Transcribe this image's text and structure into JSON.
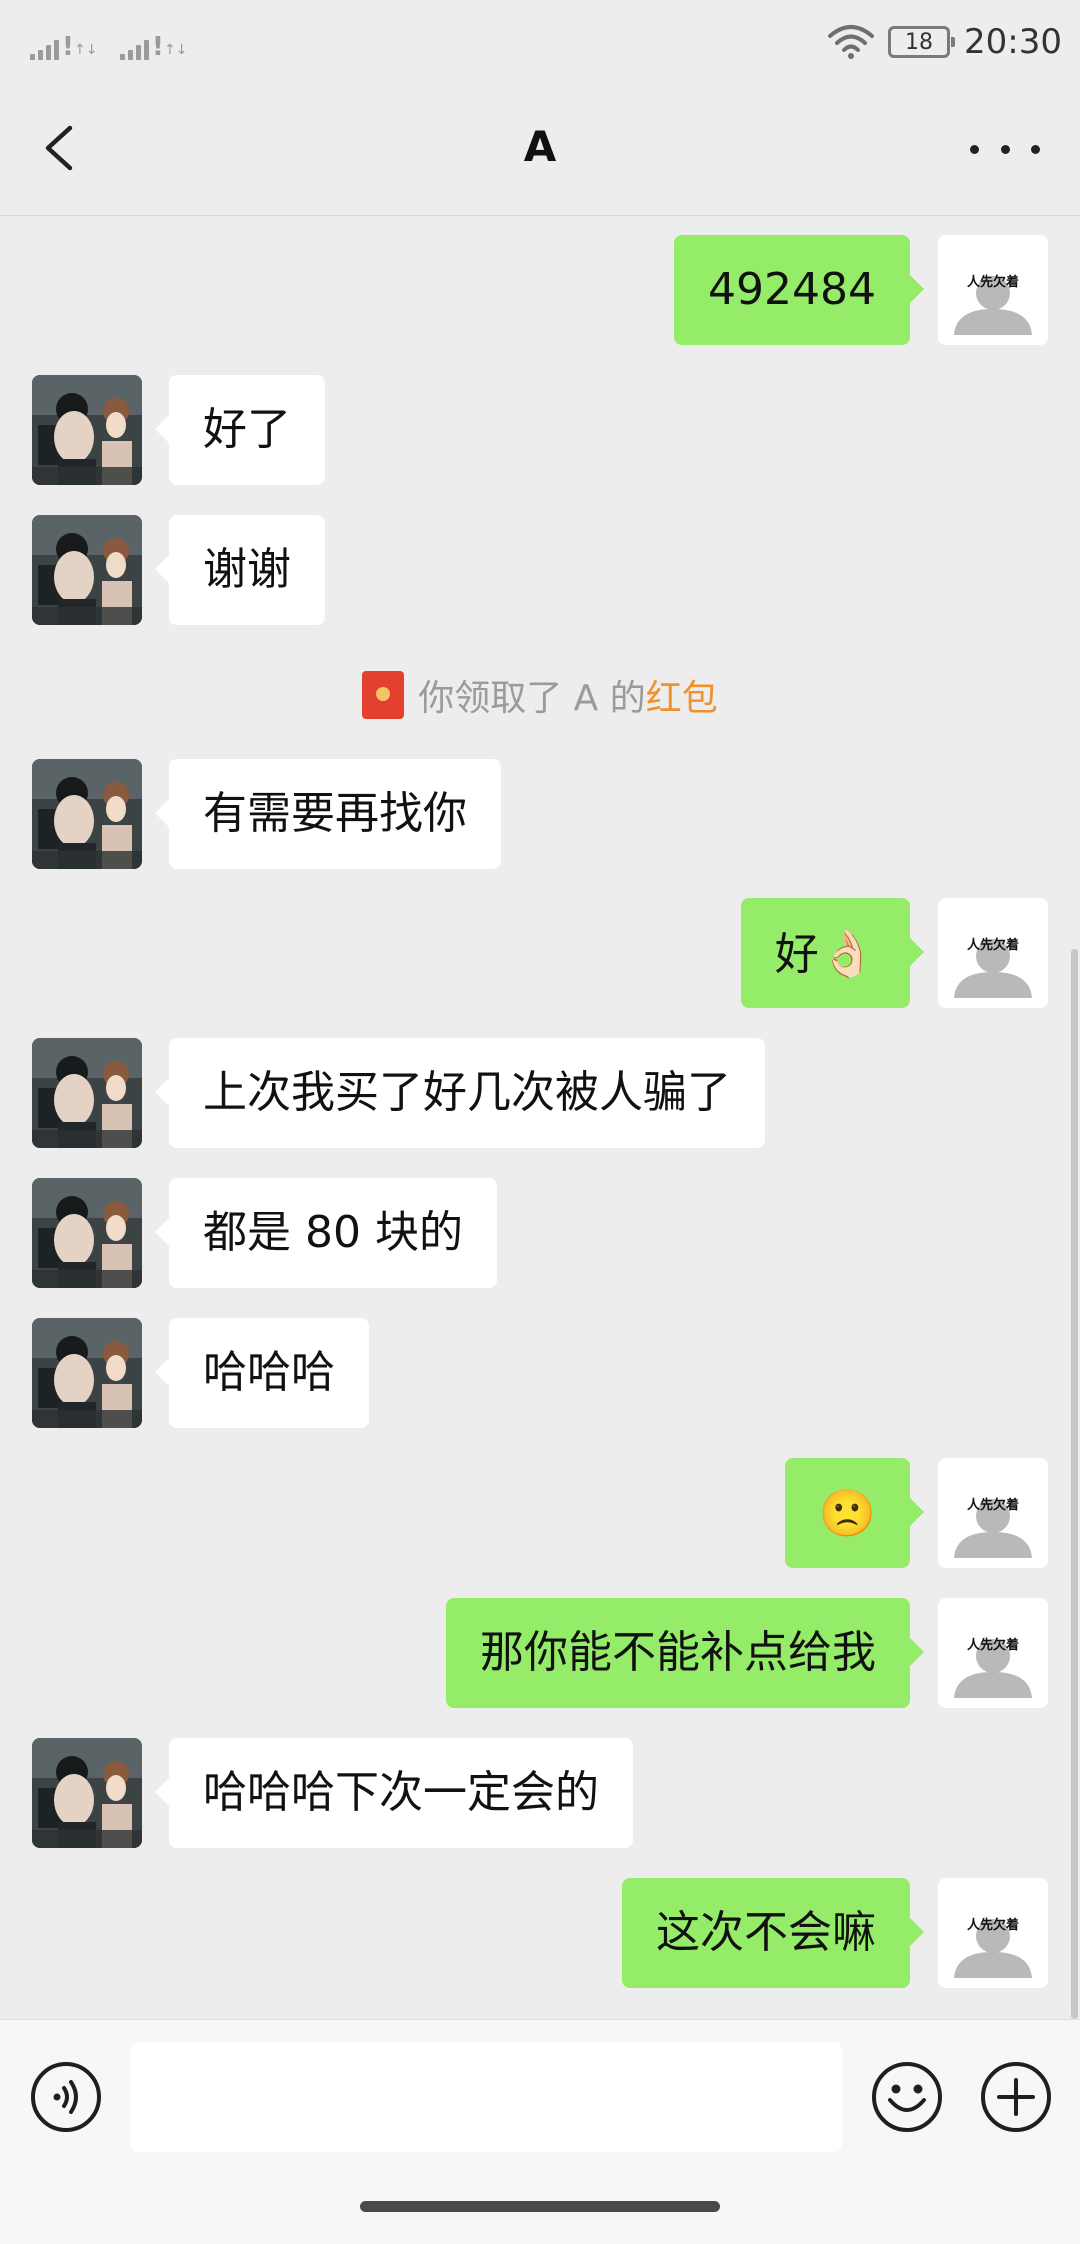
{
  "status_bar": {
    "time": "20:30",
    "battery": "18",
    "icons": [
      "signal-icon",
      "signal-icon",
      "wifi-icon",
      "battery-icon"
    ]
  },
  "header": {
    "title": "A",
    "back_icon": "chevron-left-icon",
    "more_icon": "more-horizontal-icon"
  },
  "own_avatar_caption": "人先欠着",
  "messages": [
    {
      "dir": "out",
      "text": "492484"
    },
    {
      "dir": "in",
      "text": "好了"
    },
    {
      "dir": "in",
      "text": "谢谢"
    },
    {
      "dir": "system",
      "prefix": "你领取了 A 的",
      "link": "红包",
      "icon": "red-packet-icon"
    },
    {
      "dir": "in",
      "text": "有需要再找你"
    },
    {
      "dir": "out",
      "text": "好",
      "emoji": "👌🏻"
    },
    {
      "dir": "in",
      "text": "上次我买了好几次被人骗了"
    },
    {
      "dir": "in",
      "text": "都是 80 块的"
    },
    {
      "dir": "in",
      "text": "哈哈哈"
    },
    {
      "dir": "out",
      "text": "",
      "emoji": "🙁"
    },
    {
      "dir": "out",
      "text": "那你能不能补点给我"
    },
    {
      "dir": "in",
      "text": "哈哈哈下次一定会的"
    },
    {
      "dir": "out",
      "text": "这次不会嘛"
    }
  ],
  "input_bar": {
    "value": "",
    "icons": [
      "voice-icon",
      "emoji-icon",
      "plus-icon"
    ]
  },
  "colors": {
    "background": "#ededed",
    "outgoing_bubble": "#95ec69",
    "incoming_bubble": "#ffffff",
    "link": "#f0912c"
  }
}
